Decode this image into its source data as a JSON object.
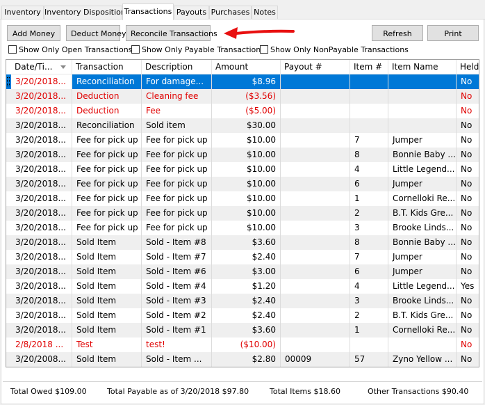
{
  "tabs": [
    "Inventory",
    "Inventory Disposition",
    "Transactions",
    "Payouts",
    "Purchases",
    "Notes"
  ],
  "toolbar": {
    "add_money": "Add Money",
    "deduct_money": "Deduct Money",
    "reconcile": "Reconcile Transactions",
    "refresh": "Refresh",
    "print": "Print"
  },
  "filters": {
    "open_only": "Show Only Open Transactions",
    "payable_only": "Show Only Payable Transactions",
    "nonpayable_only": "Show Only NonPayable Transactions"
  },
  "columns": [
    "Date/Ti...",
    "Transaction",
    "Description",
    "Amount",
    "Payout #",
    "Item #",
    "Item Name",
    "Held"
  ],
  "rows": [
    [
      "3/20/2018...",
      "Reconciliation",
      "For damage...",
      "$8.96",
      "",
      "",
      "",
      "No"
    ],
    [
      "3/20/2018...",
      "Deduction",
      "Cleaning fee",
      "($3.56)",
      "",
      "",
      "",
      "No"
    ],
    [
      "3/20/2018...",
      "Deduction",
      "Fee",
      "($5.00)",
      "",
      "",
      "",
      "No"
    ],
    [
      "3/20/2018...",
      "Reconciliation",
      "Sold item",
      "$30.00",
      "",
      "",
      "",
      "No"
    ],
    [
      "3/20/2018...",
      "Fee for pick up",
      "Fee for pick up",
      "$10.00",
      "",
      "7",
      "Jumper",
      "No"
    ],
    [
      "3/20/2018...",
      "Fee for pick up",
      "Fee for pick up",
      "$10.00",
      "",
      "8",
      "Bonnie Baby ...",
      "No"
    ],
    [
      "3/20/2018...",
      "Fee for pick up",
      "Fee for pick up",
      "$10.00",
      "",
      "4",
      "Little Legend...",
      "No"
    ],
    [
      "3/20/2018...",
      "Fee for pick up",
      "Fee for pick up",
      "$10.00",
      "",
      "6",
      "Jumper",
      "No"
    ],
    [
      "3/20/2018...",
      "Fee for pick up",
      "Fee for pick up",
      "$10.00",
      "",
      "1",
      "Cornelloki Re...",
      "No"
    ],
    [
      "3/20/2018...",
      "Fee for pick up",
      "Fee for pick up",
      "$10.00",
      "",
      "2",
      "B.T. Kids Gre...",
      "No"
    ],
    [
      "3/20/2018...",
      "Fee for pick up",
      "Fee for pick up",
      "$10.00",
      "",
      "3",
      "Brooke Linds...",
      "No"
    ],
    [
      "3/20/2018...",
      "Sold Item",
      "Sold - Item #8",
      "$3.60",
      "",
      "8",
      "Bonnie Baby ...",
      "No"
    ],
    [
      "3/20/2018...",
      "Sold Item",
      "Sold - Item #7",
      "$2.40",
      "",
      "7",
      "Jumper",
      "No"
    ],
    [
      "3/20/2018...",
      "Sold Item",
      "Sold - Item #6",
      "$3.00",
      "",
      "6",
      "Jumper",
      "No"
    ],
    [
      "3/20/2018...",
      "Sold Item",
      "Sold - Item #4",
      "$1.20",
      "",
      "4",
      "Little Legend...",
      "Yes"
    ],
    [
      "3/20/2018...",
      "Sold Item",
      "Sold - Item #3",
      "$2.40",
      "",
      "3",
      "Brooke Linds...",
      "No"
    ],
    [
      "3/20/2018...",
      "Sold Item",
      "Sold - Item #2",
      "$2.40",
      "",
      "2",
      "B.T. Kids Gre...",
      "No"
    ],
    [
      "3/20/2018...",
      "Sold Item",
      "Sold - Item #1",
      "$3.60",
      "",
      "1",
      "Cornelloki Re...",
      "No"
    ],
    [
      "2/8/2018 ...",
      "Test",
      "test!",
      "($10.00)",
      "",
      "",
      "",
      "No"
    ],
    [
      "3/20/2008...",
      "Sold Item",
      "Sold - Item ...",
      "$2.80",
      "00009",
      "57",
      "Zyno Yellow ...",
      "No"
    ]
  ],
  "row_styles": [
    "selected",
    "red",
    "red",
    "normal",
    "normal",
    "normal",
    "normal",
    "normal",
    "normal",
    "normal",
    "normal",
    "normal",
    "normal",
    "normal",
    "normal",
    "normal",
    "normal",
    "normal",
    "red",
    "normal"
  ],
  "footer": {
    "total_owed": "Total Owed  $109.00",
    "total_payable": "Total Payable as of 3/20/2018  $97.80",
    "total_items": "Total Items  $18.60",
    "other_transactions": "Other Transactions  $90.40"
  },
  "colors": {
    "selected": "#0078d7",
    "negative": "#e00000",
    "arrow": "#e81010"
  }
}
